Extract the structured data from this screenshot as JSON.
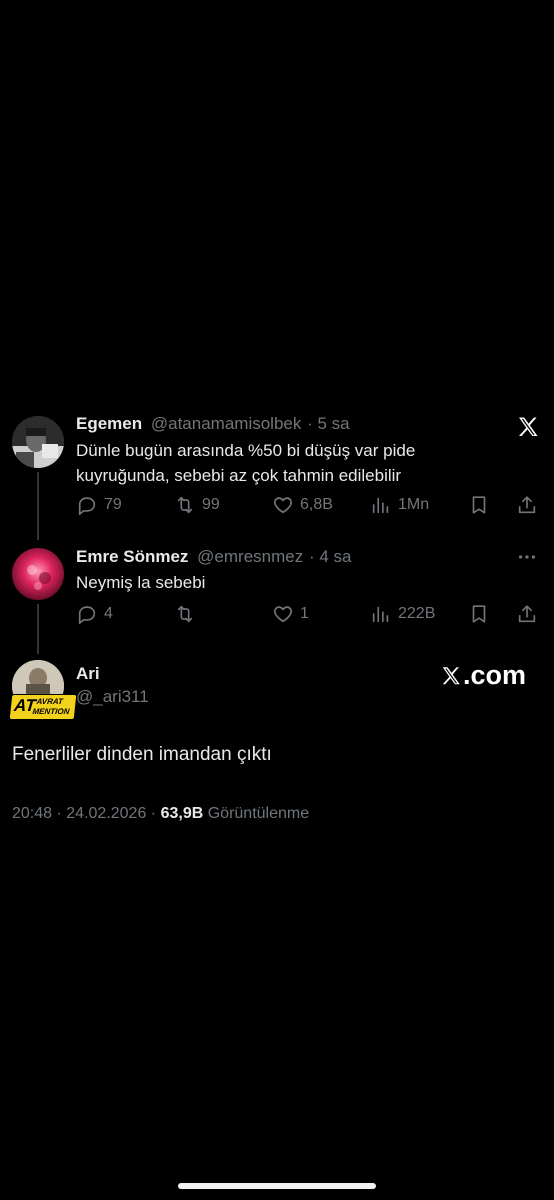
{
  "tweets": [
    {
      "name": "Egemen",
      "handle": "@atanamamisolbek",
      "time": "· 5 sa",
      "text_line1": "Dünle bugün arasında %50 bi düşüş var pide",
      "text_line2": "kuyruğunda, sebebi az çok tahmin edilebilir",
      "replies": "79",
      "retweets": "99",
      "likes": "6,8B",
      "views": "1Mn"
    },
    {
      "name": "Emre Sönmez",
      "handle": "@emresnmez",
      "time": "· 4 sa",
      "text_line1": "Neymiş la sebebi",
      "replies": "4",
      "retweets": "",
      "likes": "1",
      "views": "222B"
    }
  ],
  "main": {
    "name": "Ari",
    "handle": "@_ari311",
    "avatar_badge_text": "AT",
    "avatar_badge_sub1": "AVRAT",
    "avatar_badge_sub2": "MENTION",
    "text": "Fenerliler dinden imandan çıktı",
    "time": "20:48",
    "date": "· 24.02.2026 ·",
    "views_count": "63,9B",
    "views_label": "Görüntülenme"
  },
  "watermark": {
    "site": "X.com",
    "site_rest": ".com"
  },
  "icons": [
    "x-logo-icon",
    "reply-icon",
    "retweet-icon",
    "like-icon",
    "views-icon",
    "bookmark-icon",
    "share-icon",
    "more-icon"
  ]
}
